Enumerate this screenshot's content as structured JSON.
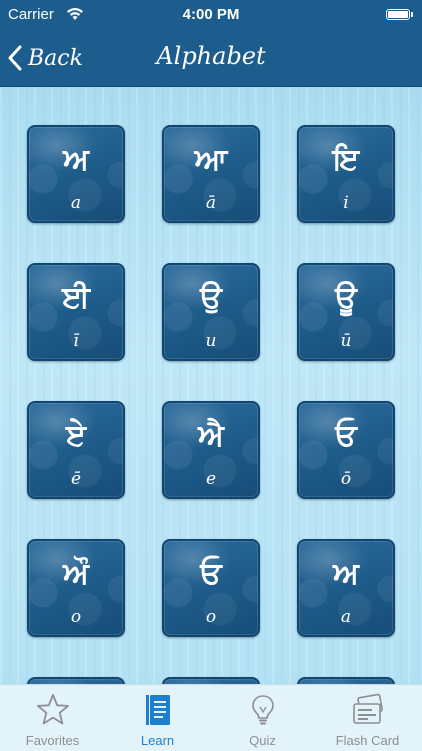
{
  "status_bar": {
    "carrier": "Carrier",
    "time": "4:00 PM"
  },
  "nav": {
    "back_label": "Back",
    "title": "Alphabet"
  },
  "letters": [
    {
      "char": "ਅ",
      "translit": "a"
    },
    {
      "char": "ਆ",
      "translit": "ā"
    },
    {
      "char": "ਇ",
      "translit": "i"
    },
    {
      "char": "ਈ",
      "translit": "ī"
    },
    {
      "char": "ਉ",
      "translit": "u"
    },
    {
      "char": "ਊ",
      "translit": "ū"
    },
    {
      "char": "ਏ",
      "translit": "ē"
    },
    {
      "char": "ਐ",
      "translit": "e"
    },
    {
      "char": "ਓ",
      "translit": "ō"
    },
    {
      "char": "ਔ",
      "translit": "o"
    },
    {
      "char": "ਓ",
      "translit": "o"
    },
    {
      "char": "ਅ",
      "translit": "a"
    }
  ],
  "tabs": [
    {
      "label": "Favorites",
      "icon": "star-icon"
    },
    {
      "label": "Learn",
      "icon": "book-icon"
    },
    {
      "label": "Quiz",
      "icon": "lightbulb-icon"
    },
    {
      "label": "Flash Card",
      "icon": "flash-card-icon"
    }
  ],
  "colors": {
    "header": "#1c5d8e",
    "tile": "#1d5a88",
    "background": "#b9e3f4",
    "tab_active": "#1c7fd0",
    "tab_inactive": "#8e8e93"
  }
}
